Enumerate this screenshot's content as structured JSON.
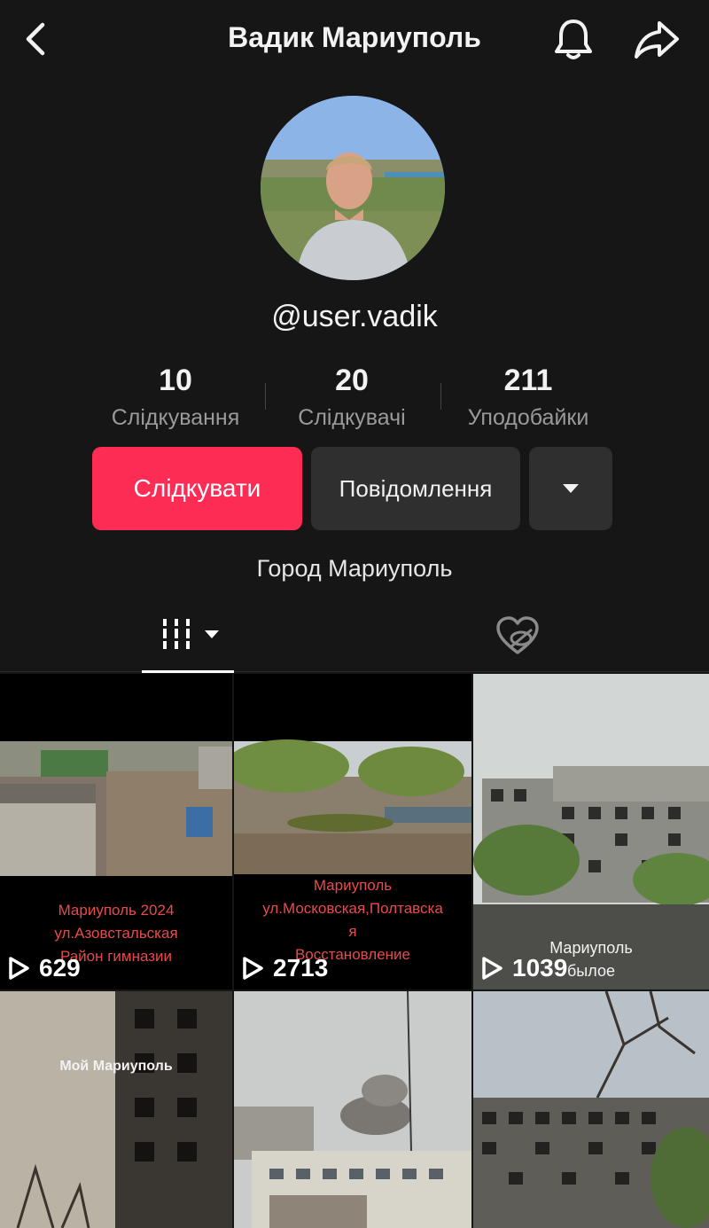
{
  "header": {
    "title": "Вадик Мариуполь",
    "back_icon": "chevron-left-icon",
    "bell_icon": "bell-icon",
    "share_icon": "share-arrow-icon"
  },
  "profile": {
    "handle": "@user.vadik",
    "bio": "Город Мариуполь"
  },
  "stats": [
    {
      "value": "10",
      "label": "Слідкування"
    },
    {
      "value": "20",
      "label": "Слідкувачі"
    },
    {
      "value": "211",
      "label": "Уподобайки"
    }
  ],
  "actions": {
    "follow_label": "Слідкувати",
    "message_label": "Повідомлення",
    "more_icon": "caret-down-icon"
  },
  "tabs": {
    "videos_icon": "grid-bars-icon",
    "liked_icon": "hidden-heart-icon"
  },
  "videos": [
    {
      "caption_lines": [
        "Мариуполь 2024",
        "ул.Азовстальская",
        "Район гимназии"
      ],
      "views": "629"
    },
    {
      "caption_lines": [
        "Мариуполь",
        "ул.Московская,Полтавска",
        "я",
        "Восстановление"
      ],
      "views": "2713"
    },
    {
      "caption_lines": [
        "Мариуполь",
        "былое"
      ],
      "views": "1039"
    },
    {
      "caption_lines": [
        "Мой Мариуполь"
      ],
      "views": ""
    },
    {
      "caption_lines": [],
      "views": ""
    },
    {
      "caption_lines": [],
      "views": ""
    }
  ],
  "colors": {
    "background": "#161616",
    "accent": "#fd2c55",
    "secondary_button": "#2f2f2f",
    "caption_red": "#e84a4a"
  }
}
